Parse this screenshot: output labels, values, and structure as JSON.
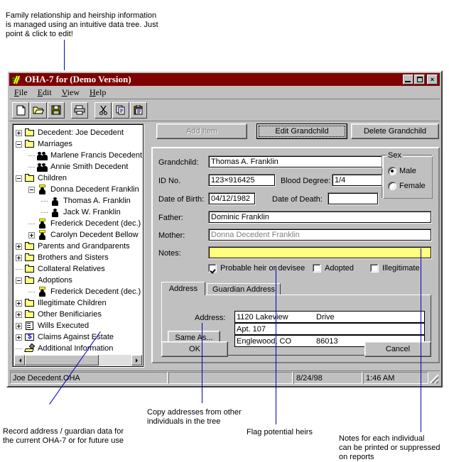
{
  "annotations": {
    "top": "Family relationship and heirship information\nis managed using an intuitive data tree.  Just\npoint & click to edit!",
    "bottom_left": "Record address / guardian data for\nthe current OHA-7 or for future use",
    "bottom_copy": "Copy addresses from other\nindividuals in the tree",
    "bottom_flag": "Flag potential heirs",
    "bottom_notes": "Notes for each individual\ncan be printed or suppressed\non reports"
  },
  "window": {
    "title": "OHA-7 for (Demo Version)",
    "icon": "app-icon",
    "buttons": {
      "minimize": "minimize-button",
      "maximize": "maximize-button",
      "close": "×"
    }
  },
  "menu": {
    "items": [
      {
        "label": "File",
        "accel": "F"
      },
      {
        "label": "Edit",
        "accel": "E"
      },
      {
        "label": "View",
        "accel": "V"
      },
      {
        "label": "Help",
        "accel": "H"
      }
    ]
  },
  "toolbar": {
    "buttons": [
      {
        "name": "new-icon",
        "glyph": "new"
      },
      {
        "name": "open-icon",
        "glyph": "open"
      },
      {
        "name": "save-icon",
        "glyph": "save"
      },
      {
        "name": "print-icon",
        "glyph": "print"
      },
      {
        "name": "cut-icon",
        "glyph": "cut"
      },
      {
        "name": "copy-icon",
        "glyph": "copy"
      },
      {
        "name": "paste-icon",
        "glyph": "paste"
      }
    ]
  },
  "tree": {
    "nodes": [
      {
        "label": "Decedent: Joe Decedent",
        "indent": 0,
        "expander": "plus",
        "icon": "folder"
      },
      {
        "label": "Marriages",
        "indent": 0,
        "expander": "minus",
        "icon": "folder"
      },
      {
        "label": "Marlene Francis Decedent",
        "indent": 1,
        "expander": "none",
        "icon": "couple"
      },
      {
        "label": "Annie Smith Decedent",
        "indent": 1,
        "expander": "none",
        "icon": "couple"
      },
      {
        "label": "Children",
        "indent": 0,
        "expander": "minus",
        "icon": "folder"
      },
      {
        "label": "Donna Decedent Franklin",
        "indent": 1,
        "expander": "minus",
        "icon": "halo"
      },
      {
        "label": "Thomas A. Franklin",
        "indent": 2,
        "expander": "none",
        "icon": "person"
      },
      {
        "label": "Jack W. Franklin",
        "indent": 2,
        "expander": "none",
        "icon": "person"
      },
      {
        "label": "Frederick Decedent (dec.)",
        "indent": 1,
        "expander": "none",
        "icon": "halo"
      },
      {
        "label": "Carolyn Decedent Bellow",
        "indent": 1,
        "expander": "plus",
        "icon": "halo"
      },
      {
        "label": "Parents and Grandparents",
        "indent": 0,
        "expander": "plus",
        "icon": "folder"
      },
      {
        "label": "Brothers and Sisters",
        "indent": 0,
        "expander": "plus",
        "icon": "folder"
      },
      {
        "label": "Collateral Relatives",
        "indent": 0,
        "expander": "none",
        "icon": "folder"
      },
      {
        "label": "Adoptions",
        "indent": 0,
        "expander": "minus",
        "icon": "folder"
      },
      {
        "label": "Frederick Decedent (dec.)",
        "indent": 1,
        "expander": "none",
        "icon": "halo"
      },
      {
        "label": "Illegitimate Children",
        "indent": 0,
        "expander": "plus",
        "icon": "folder"
      },
      {
        "label": "Other Benificiaries",
        "indent": 0,
        "expander": "plus",
        "icon": "folder"
      },
      {
        "label": "Wills Executed",
        "indent": 0,
        "expander": "plus",
        "icon": "doc"
      },
      {
        "label": "Claims Against Estate",
        "indent": 0,
        "expander": "plus",
        "icon": "money"
      },
      {
        "label": "Additional Information",
        "indent": 0,
        "expander": "none",
        "icon": "pen"
      }
    ]
  },
  "actions": {
    "add_item": "Add Item",
    "edit": "Edit Grandchild",
    "delete": "Delete Grandchild"
  },
  "form": {
    "labels": {
      "name": "Grandchild:",
      "id_no": "ID No.",
      "blood_degree": "Blood Degree:",
      "dob": "Date of Birth:",
      "dod": "Date of Death:",
      "father": "Father:",
      "mother": "Mother:",
      "notes": "Notes:"
    },
    "values": {
      "name": "Thomas A. Franklin",
      "id_no": "123×916425",
      "blood_degree": "1/4",
      "dob": "04/12/1982",
      "dod": "",
      "father": "Dominic Franklin",
      "mother": "Donna Decedent Franklin",
      "notes": ""
    },
    "sex": {
      "title": "Sex",
      "male": "Male",
      "female": "Female",
      "selected": "Male"
    },
    "flags": [
      {
        "label": "Probable heir or devisee",
        "checked": true
      },
      {
        "label": "Adopted",
        "checked": false
      },
      {
        "label": "Illegitimate",
        "checked": false
      }
    ]
  },
  "tabs": {
    "items": [
      {
        "label": "Address",
        "active": true
      },
      {
        "label": "Guardian Address",
        "active": false
      }
    ],
    "address": {
      "label": "Address:",
      "same_as_button": "Same As...",
      "rows": [
        {
          "col1": "1120 Lakeview",
          "col2": "Drive"
        },
        {
          "col1": "Apt. 107",
          "col2": ""
        },
        {
          "col1": "Englewood, CO",
          "col2": "86013"
        }
      ]
    }
  },
  "dialog_buttons": {
    "ok": "OK",
    "cancel": "Cancel"
  },
  "statusbar": {
    "file": "Joe Decedent.OHA",
    "middle": "",
    "date": "8/24/98",
    "time": "1:46 AM"
  },
  "colors": {
    "titlebar": "#7e0000",
    "face": "#c0c0c0",
    "notes_highlight": "#ffff80",
    "annotation_line": "#0000bb"
  }
}
